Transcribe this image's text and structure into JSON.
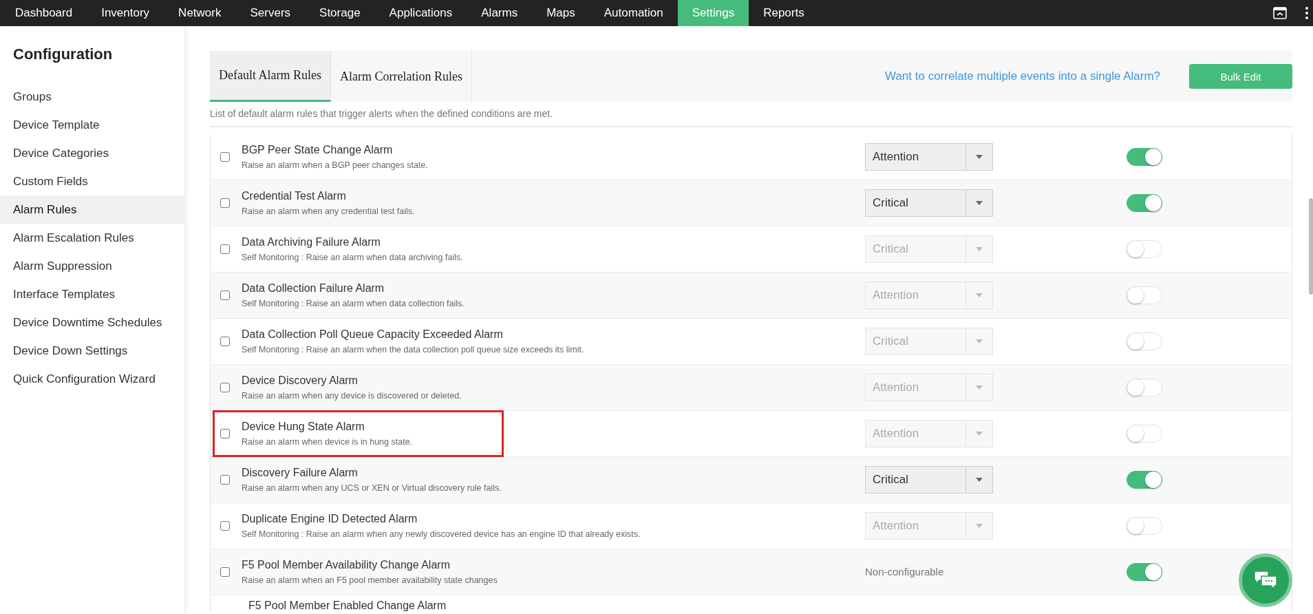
{
  "nav": [
    {
      "label": "Dashboard",
      "selected": false
    },
    {
      "label": "Inventory",
      "selected": false
    },
    {
      "label": "Network",
      "selected": false
    },
    {
      "label": "Servers",
      "selected": false
    },
    {
      "label": "Storage",
      "selected": false
    },
    {
      "label": "Applications",
      "selected": false
    },
    {
      "label": "Alarms",
      "selected": false
    },
    {
      "label": "Maps",
      "selected": false
    },
    {
      "label": "Automation",
      "selected": false
    },
    {
      "label": "Settings",
      "selected": true
    },
    {
      "label": "Reports",
      "selected": false
    }
  ],
  "sidebar": {
    "title": "Configuration",
    "items": [
      {
        "label": "Groups",
        "selected": false
      },
      {
        "label": "Device Template",
        "selected": false
      },
      {
        "label": "Device Categories",
        "selected": false
      },
      {
        "label": "Custom Fields",
        "selected": false
      },
      {
        "label": "Alarm Rules",
        "selected": true
      },
      {
        "label": "Alarm Escalation Rules",
        "selected": false
      },
      {
        "label": "Alarm Suppression",
        "selected": false
      },
      {
        "label": "Interface Templates",
        "selected": false
      },
      {
        "label": "Device Downtime Schedules",
        "selected": false
      },
      {
        "label": "Device Down Settings",
        "selected": false
      },
      {
        "label": "Quick Configuration Wizard",
        "selected": false
      }
    ]
  },
  "tabs": [
    {
      "label": "Default Alarm Rules",
      "selected": true
    },
    {
      "label": "Alarm Correlation Rules",
      "selected": false
    }
  ],
  "help_link": "Want to correlate multiple events into a single Alarm?",
  "bulk_edit_button": "Bulk Edit",
  "description": "List of default alarm rules that trigger alerts when the defined conditions are met.",
  "rules": [
    {
      "title": "BGP Peer State Change Alarm",
      "description": "Raise an alarm when a BGP peer changes state.",
      "kind": "select",
      "severity": "Attention",
      "on": true,
      "checked": false,
      "highlighted": false
    },
    {
      "title": "Credential Test Alarm",
      "description": "Raise an alarm when any credential test fails.",
      "kind": "select",
      "severity": "Critical",
      "on": true,
      "checked": false,
      "highlighted": false
    },
    {
      "title": "Data Archiving Failure Alarm",
      "description": "Self Monitoring : Raise an alarm when data archiving fails.",
      "kind": "select",
      "severity": "Critical",
      "on": false,
      "checked": false,
      "highlighted": false
    },
    {
      "title": "Data Collection Failure Alarm",
      "description": "Self Monitoring : Raise an alarm when data collection fails.",
      "kind": "select",
      "severity": "Attention",
      "on": false,
      "checked": false,
      "highlighted": false
    },
    {
      "title": "Data Collection Poll Queue Capacity Exceeded Alarm",
      "description": "Self Monitoring : Raise an alarm when the data collection poll queue size exceeds its limit.",
      "kind": "select",
      "severity": "Critical",
      "on": false,
      "checked": false,
      "highlighted": false
    },
    {
      "title": "Device Discovery Alarm",
      "description": "Raise an alarm when any device is discovered or deleted.",
      "kind": "select",
      "severity": "Attention",
      "on": false,
      "checked": false,
      "highlighted": false
    },
    {
      "title": "Device Hung State Alarm",
      "description": "Raise an alarm when device is in hung state.",
      "kind": "select",
      "severity": "Attention",
      "on": false,
      "checked": false,
      "highlighted": true
    },
    {
      "title": "Discovery Failure Alarm",
      "description": "Raise an alarm when any UCS or XEN or Virtual discovery rule fails.",
      "kind": "select",
      "severity": "Critical",
      "on": true,
      "checked": false,
      "highlighted": false
    },
    {
      "title": "Duplicate Engine ID Detected Alarm",
      "description": "Self Monitoring : Raise an alarm when any newly discovered device has an engine ID that already exists.",
      "kind": "select",
      "severity": "Attention",
      "on": false,
      "checked": false,
      "highlighted": false
    },
    {
      "title": "F5 Pool Member Availability Change Alarm",
      "description": "Raise an alarm when an F5 pool member availability state changes",
      "kind": "text",
      "severity": "Non-configurable",
      "on": true,
      "checked": false,
      "highlighted": false
    },
    {
      "title": "F5 Pool Member Enabled Change Alarm",
      "kind": "cut"
    }
  ]
}
